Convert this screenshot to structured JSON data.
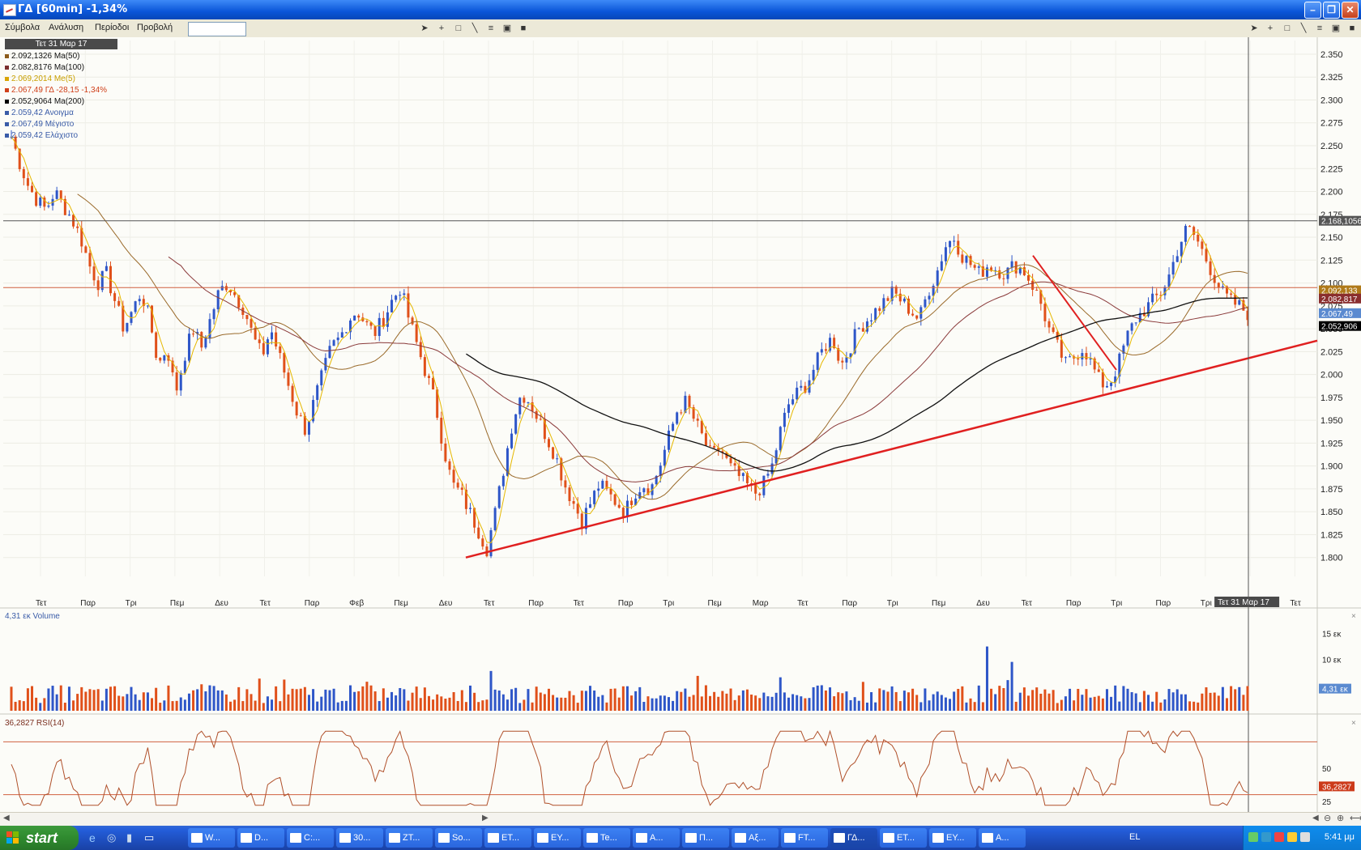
{
  "window": {
    "title": "ΓΔ [60min] -1,34%"
  },
  "menu": {
    "items": [
      "Σύμβολα",
      "Ανάλυση",
      "Περίοδοι",
      "Προβολή"
    ],
    "search_value": ""
  },
  "legend": {
    "date": "Τετ 31 Μαρ 17",
    "rows": [
      {
        "text": "2.092,1326 Ma(50)",
        "color": "#8b5a1a"
      },
      {
        "text": "2.082,8176 Ma(100)",
        "color": "#7a2e2e"
      },
      {
        "text": "2.069,2014 Me(5)",
        "color": "#d9a400"
      },
      {
        "text": "2.067,49 ΓΔ -28,15 -1,34%",
        "color": "#d0401a"
      },
      {
        "text": "2.052,9064 Ma(200)",
        "color": "#000000"
      },
      {
        "text": "2.059,42 Ανοιγμα",
        "color": "#3a5ca8"
      },
      {
        "text": "2.067,49 Μέγιστο",
        "color": "#3a5ca8"
      },
      {
        "text": "2.059,42 Ελάχιστο",
        "color": "#3a5ca8"
      }
    ]
  },
  "price_axis": {
    "ticks": [
      "2.350",
      "2.325",
      "2.300",
      "2.275",
      "2.250",
      "2.225",
      "2.200",
      "2.175",
      "2.150",
      "2.125",
      "2.100",
      "2.075",
      "2.050",
      "2.025",
      "2.000",
      "1.975",
      "1.950",
      "1.925",
      "1.900",
      "1.875",
      "1.850",
      "1.825",
      "1.800"
    ],
    "tags": [
      {
        "text": "2.168,1056",
        "color": "#555555"
      },
      {
        "text": "2.092,133",
        "color": "#b07a1a"
      },
      {
        "text": "2.082,817",
        "color": "#8a2e2e"
      },
      {
        "text": "2.067,49",
        "color": "#5a8ad0"
      },
      {
        "text": "2.052,906",
        "color": "#000000"
      }
    ]
  },
  "time_axis": {
    "labels": [
      "Τετ",
      "Παρ",
      "Τρι",
      "Πεμ",
      "Δευ",
      "Τετ",
      "Παρ",
      "Φεβ",
      "Πεμ",
      "Δευ",
      "Τετ",
      "Παρ",
      "Τετ",
      "Παρ",
      "Τρι",
      "Πεμ",
      "Μαρ",
      "Τετ",
      "Παρ",
      "Τρι",
      "Πεμ",
      "Δευ",
      "Τετ",
      "Παρ",
      "Τρι",
      "Παρ",
      "Τρι",
      "Τετ 31 Μαρ 17",
      "Τετ"
    ]
  },
  "volume_panel": {
    "label": "4,31 εκ Volume",
    "ticks": [
      "15 εκ",
      "10 εκ"
    ],
    "tag": "4,31 εκ"
  },
  "rsi_panel": {
    "label": "36,2827 RSI(14)",
    "ticks": [
      "50",
      "25"
    ],
    "tag": "36,2827"
  },
  "chart_data": [
    {
      "type": "candlestick",
      "title": "ΓΔ [60min]",
      "ylim": [
        1790,
        2365
      ],
      "trendlines": [
        {
          "name": "support",
          "color": "#e02020"
        },
        {
          "name": "resistance 2.168",
          "color": "#555555"
        },
        {
          "name": "2.092 level",
          "color": "#d06040"
        },
        {
          "name": "down trend",
          "color": "#e02020"
        }
      ],
      "close_path": [
        2260,
        2230,
        2205,
        2190,
        2180,
        2200,
        2185,
        2170,
        2150,
        2120,
        2100,
        2110,
        2080,
        2050,
        2070,
        2090,
        2060,
        2010,
        2030,
        1980,
        2020,
        2050,
        2030,
        2060,
        2090,
        2100,
        2085,
        2070,
        2040,
        2020,
        2050,
        2020,
        1990,
        1960,
        1940,
        1970,
        2000,
        2030,
        2040,
        2060,
        2070,
        2055,
        2045,
        2060,
        2080,
        2095,
        2060,
        2030,
        2000,
        1970,
        1920,
        1880,
        1870,
        1850,
        1830,
        1810,
        1850,
        1900,
        1950,
        1980,
        1970,
        1950,
        1930,
        1910,
        1880,
        1860,
        1840,
        1860,
        1880,
        1870,
        1860,
        1850,
        1870,
        1880,
        1875,
        1900,
        1930,
        1960,
        1970,
        1950,
        1930,
        1910,
        1920,
        1900,
        1890,
        1880,
        1870,
        1880,
        1900,
        1940,
        1970,
        1980,
        1990,
        2010,
        2030,
        2040,
        2010,
        2030,
        2050,
        2060,
        2070,
        2080,
        2090,
        2080,
        2070,
        2060,
        2090,
        2110,
        2140,
        2150,
        2130,
        2120,
        2110,
        2120,
        2115,
        2110,
        2120,
        2115,
        2100,
        2080,
        2050,
        2030,
        2010,
        2020,
        2030,
        2010,
        1990,
        1990,
        2010,
        2040,
        2060,
        2070,
        2080,
        2090,
        2110,
        2140,
        2160,
        2150,
        2130,
        2110,
        2090,
        2080,
        2075,
        2067
      ]
    },
    {
      "type": "bar",
      "title": "Volume",
      "ylim": [
        0,
        17
      ]
    },
    {
      "type": "line",
      "title": "RSI(14)",
      "ylim": [
        20,
        80
      ]
    }
  ],
  "taskbar": {
    "start_label": "start",
    "tasks": [
      "W...",
      "D...",
      "C:...",
      "30...",
      "ZT...",
      "So...",
      "ET...",
      "EY...",
      "Te...",
      "A...",
      "Π...",
      "Aξ...",
      "FT...",
      "ΓΔ...",
      "ET...",
      "EY...",
      "A..."
    ],
    "active_index": 13,
    "language": "EL",
    "clock": "5:41 μμ"
  }
}
